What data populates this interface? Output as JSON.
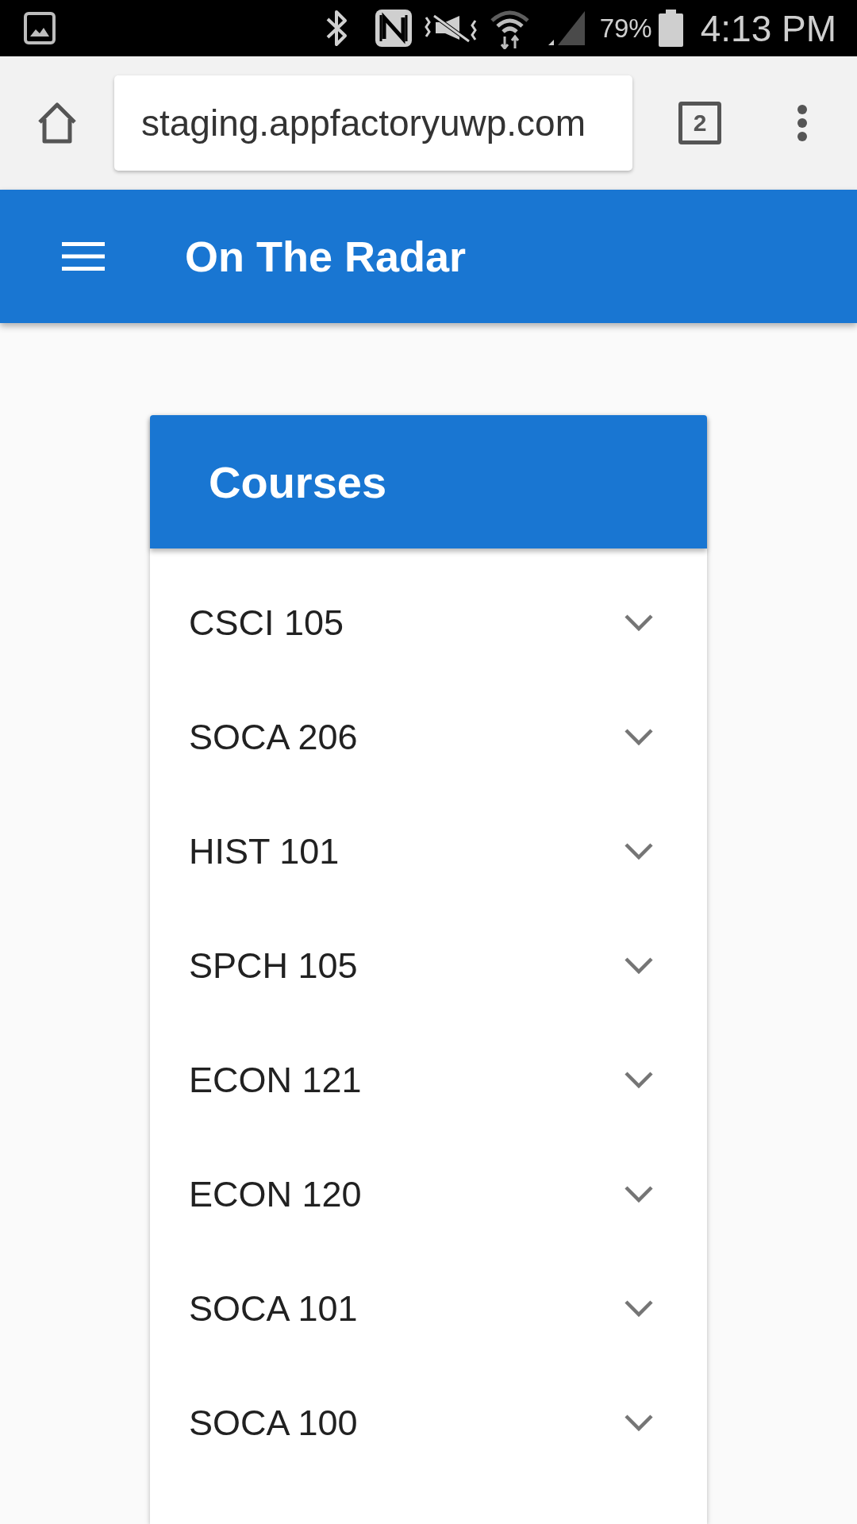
{
  "status_bar": {
    "battery_text": "79%",
    "time": "4:13 PM"
  },
  "browser": {
    "url": "staging.appfactoryuwp.com",
    "tab_count": "2"
  },
  "app_bar": {
    "title": "On The Radar"
  },
  "card": {
    "title": "Courses",
    "courses": [
      {
        "name": "CSCI 105",
        "expanded": false
      },
      {
        "name": "SOCA 206",
        "expanded": false
      },
      {
        "name": "HIST 101",
        "expanded": false
      },
      {
        "name": "SPCH 105",
        "expanded": false
      },
      {
        "name": "ECON 121",
        "expanded": false
      },
      {
        "name": "ECON 120",
        "expanded": false
      },
      {
        "name": "SOCA 101",
        "expanded": false
      },
      {
        "name": "SOCA 100",
        "expanded": false
      }
    ]
  }
}
